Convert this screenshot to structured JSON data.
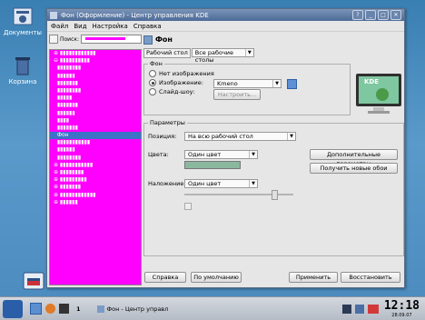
{
  "desktop": {
    "icons": [
      {
        "name": "documents-icon",
        "label": "Документы"
      },
      {
        "name": "trash-icon",
        "label": "Корзина"
      },
      {
        "name": "install-icon",
        "label": ""
      }
    ]
  },
  "window": {
    "title": "Фон (Оформление) - Центр управления KDE",
    "menu": [
      "Файл",
      "Вид",
      "Настройка",
      "Справка"
    ]
  },
  "sidebar": {
    "search_label": "Поиск:",
    "selected_item": "Фон"
  },
  "page": {
    "title": "Фон",
    "tab_label": "Рабочий стол",
    "desktop_select": "Все рабочие столы",
    "bg_group_title": "Фон",
    "radio_none": "Нет изображения",
    "radio_picture": "Изображение:",
    "picture_value": "Kmeno",
    "radio_slideshow": "Слайд-шоу:",
    "setup_button": "Настроить...",
    "params_group_title": "Параметры",
    "position_label": "Позиция:",
    "position_value": "На всю рабочий стол",
    "colors_label": "Цвета:",
    "colors_value": "Один цвет",
    "blend_label": "Наложение:",
    "blend_value": "Один цвет",
    "advanced_button": "Дополнительные параметры",
    "get_new_button": "Получить новые обои",
    "monitor_text": "KDE",
    "color_swatch": "#8ab89e"
  },
  "footer": {
    "help": "Справка",
    "defaults": "По умолчанию",
    "apply": "Применить",
    "reset": "Восстановить"
  },
  "taskbar": {
    "desktop_num": "1",
    "task_label": "Фон - Центр управл",
    "clock": "12:18",
    "date": "28.09.07"
  },
  "colors": {
    "accent": "#3d73c6",
    "magenta": "#ff00ff"
  }
}
